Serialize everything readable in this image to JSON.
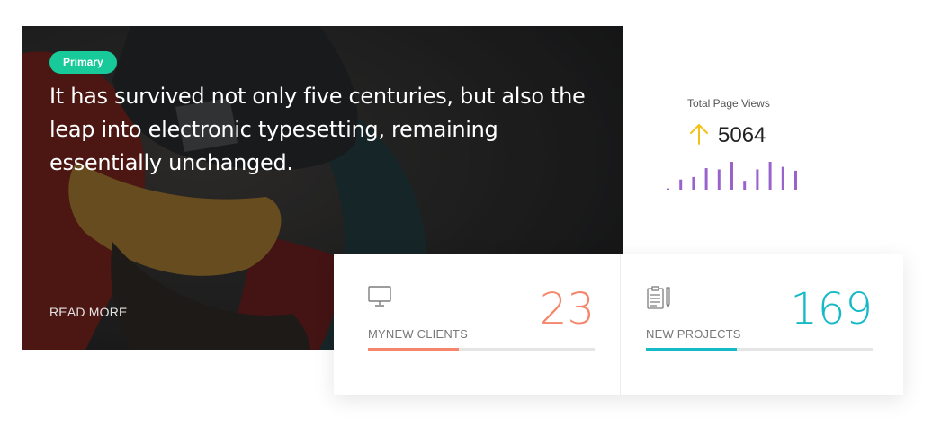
{
  "hero": {
    "badge": "Primary",
    "text": "It has survived not only five centuries, but also the leap into electronic typesetting, remaining essentially unchanged.",
    "read_more": "READ MORE",
    "badge_color": "#18c99a"
  },
  "page_views": {
    "label": "Total Page Views",
    "value": "5064",
    "trend_icon": "arrow-up-icon",
    "arrow_color": "#f5c116",
    "spark_color": "#9a63cc",
    "spark_values": [
      0.5,
      4,
      5,
      8.5,
      8,
      11,
      3.5,
      8,
      11,
      9,
      7.5
    ]
  },
  "stats": [
    {
      "icon": "monitor-icon",
      "value": "23",
      "label": "MYNEW CLIENTS",
      "color": "#f4876b",
      "progress": 0.4
    },
    {
      "icon": "clipboard-icon",
      "value": "169",
      "label": "NEW PROJECTS",
      "color": "#16b9c6",
      "progress": 0.4
    }
  ]
}
